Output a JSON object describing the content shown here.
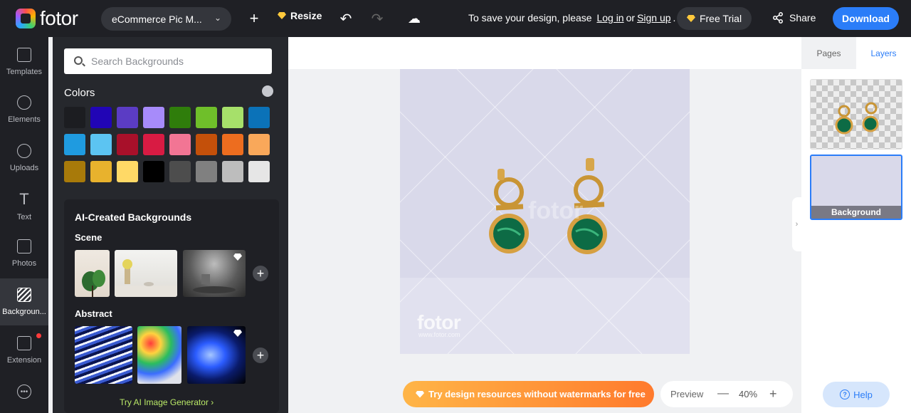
{
  "header": {
    "logo_text": "fotor",
    "doc_name": "eCommerce Pic M...",
    "resize_label": "Resize",
    "save_message": "To save your design, please",
    "login_label": "Log in",
    "or_text": "or",
    "signup_label": "Sign up",
    "period": ".",
    "free_trial_label": "Free Trial",
    "share_label": "Share",
    "download_label": "Download"
  },
  "rail": {
    "items": [
      {
        "label": "Templates",
        "icon": "templates-icon"
      },
      {
        "label": "Elements",
        "icon": "elements-icon"
      },
      {
        "label": "Uploads",
        "icon": "uploads-icon"
      },
      {
        "label": "Text",
        "icon": "text-icon"
      },
      {
        "label": "Photos",
        "icon": "photos-icon"
      },
      {
        "label": "Backgroun...",
        "icon": "backgrounds-icon"
      },
      {
        "label": "Extension",
        "icon": "extension-icon"
      }
    ]
  },
  "panel": {
    "search_placeholder": "Search Backgrounds",
    "colors_title": "Colors",
    "swatches": [
      "#1c1d21",
      "#2105b5",
      "#5b3cc4",
      "#a78bfa",
      "#2f7d0b",
      "#6fbf2a",
      "#a6e06a",
      "#0b72b8",
      "#1f9be0",
      "#5cc4f2",
      "#a8102a",
      "#d81b43",
      "#f27594",
      "#c4500a",
      "#ed6d1f",
      "#f9a85a",
      "#a87a0a",
      "#e8b22d",
      "#ffd966",
      "#000000",
      "#4d4d4d",
      "#808080",
      "#bdbdbd",
      "#e6e6e6"
    ],
    "ai_title": "AI-Created Backgrounds",
    "scene_title": "Scene",
    "abstract_title": "Abstract",
    "try_ai_label": "Try AI Image Generator"
  },
  "canvas": {
    "watermark_main": "fotor",
    "watermark_sub": "www.fotor.com",
    "promo_label": "Try design resources without watermarks for free",
    "preview_label": "Preview",
    "zoom_value": "40%"
  },
  "right": {
    "tab_pages": "Pages",
    "tab_layers": "Layers",
    "layer_background_label": "Background",
    "help_label": "Help"
  }
}
